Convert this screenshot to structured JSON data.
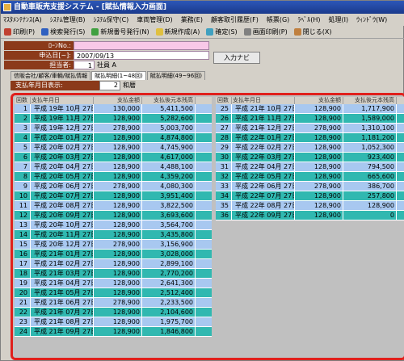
{
  "window": {
    "title": "自動車販売支援システム - [賦払情報入力画面]"
  },
  "menu": [
    "ﾏｽﾀﾒﾝﾃﾅﾝｽ(A)",
    "ｼｽﾃﾑ管理(B)",
    "ｼｽﾃﾑ保守(C)",
    "車両管理(D)",
    "業務(E)",
    "顧客取引履歴(F)",
    "帳票(G)",
    "ﾗﾍﾞﾙ(H)",
    "処理(I)",
    "ｳｨﾝﾄﾞｳ(W)"
  ],
  "toolbar": [
    "印刷(P)",
    "検索発行(S)",
    "新規番号発行(N)",
    "新規作成(A)",
    "確定(S)",
    "画面印刷(P)",
    "閉じる(X)"
  ],
  "form": {
    "loan_label": "ﾛｰﾝNo.:",
    "loan_value": "",
    "date_label": "申込日[~]:",
    "date_value": "2007/09/13",
    "person_label": "担当者:",
    "person_code": "1",
    "person_name": "社員 A"
  },
  "nav_button": "入力ナビ",
  "tabs": [
    "信販会社/顧客/車輛/賦払情報",
    "賦払明細(1~48回)",
    "賦払明細(49~96回)"
  ],
  "display": {
    "label": "支払年月日表示:",
    "value": "2",
    "text": "和暦"
  },
  "headers": [
    "回数",
    "支払年月日",
    "支払金額",
    "支払後元本残高"
  ],
  "left_rows": [
    [
      "1",
      "平成 19年 10月 27日",
      "130,000",
      "5,411,500"
    ],
    [
      "2",
      "平成 19年 11月 27日",
      "128,900",
      "5,282,600"
    ],
    [
      "3",
      "平成 19年 12月 27日",
      "278,900",
      "5,003,700"
    ],
    [
      "4",
      "平成 20年 01月 27日",
      "128,900",
      "4,874,800"
    ],
    [
      "5",
      "平成 20年 02月 27日",
      "128,900",
      "4,745,900"
    ],
    [
      "6",
      "平成 20年 03月 27日",
      "128,900",
      "4,617,000"
    ],
    [
      "7",
      "平成 20年 04月 27日",
      "128,900",
      "4,488,100"
    ],
    [
      "8",
      "平成 20年 05月 27日",
      "128,900",
      "4,359,200"
    ],
    [
      "9",
      "平成 20年 06月 27日",
      "278,900",
      "4,080,300"
    ],
    [
      "10",
      "平成 20年 07月 27日",
      "128,900",
      "3,951,400"
    ],
    [
      "11",
      "平成 20年 08月 27日",
      "128,900",
      "3,822,500"
    ],
    [
      "12",
      "平成 20年 09月 27日",
      "128,900",
      "3,693,600"
    ],
    [
      "13",
      "平成 20年 10月 27日",
      "128,900",
      "3,564,700"
    ],
    [
      "14",
      "平成 20年 11月 27日",
      "128,900",
      "3,435,800"
    ],
    [
      "15",
      "平成 20年 12月 27日",
      "278,900",
      "3,156,900"
    ],
    [
      "16",
      "平成 21年 01月 27日",
      "128,900",
      "3,028,000"
    ],
    [
      "17",
      "平成 21年 02月 27日",
      "128,900",
      "2,899,100"
    ],
    [
      "18",
      "平成 21年 03月 27日",
      "128,900",
      "2,770,200"
    ],
    [
      "19",
      "平成 21年 04月 27日",
      "128,900",
      "2,641,300"
    ],
    [
      "20",
      "平成 21年 05月 27日",
      "128,900",
      "2,512,400"
    ],
    [
      "21",
      "平成 21年 06月 27日",
      "278,900",
      "2,233,500"
    ],
    [
      "22",
      "平成 21年 07月 27日",
      "128,900",
      "2,104,600"
    ],
    [
      "23",
      "平成 21年 08月 27日",
      "128,900",
      "1,975,700"
    ],
    [
      "24",
      "平成 21年 09月 27日",
      "128,900",
      "1,846,800"
    ]
  ],
  "right_rows": [
    [
      "25",
      "平成 21年 10月 27日",
      "128,900",
      "1,717,900"
    ],
    [
      "26",
      "平成 21年 11月 27日",
      "128,900",
      "1,589,000"
    ],
    [
      "27",
      "平成 21年 12月 27日",
      "278,900",
      "1,310,100"
    ],
    [
      "28",
      "平成 22年 01月 27日",
      "128,900",
      "1,181,200"
    ],
    [
      "29",
      "平成 22年 02月 27日",
      "128,900",
      "1,052,300"
    ],
    [
      "30",
      "平成 22年 03月 27日",
      "128,900",
      "923,400"
    ],
    [
      "31",
      "平成 22年 04月 27日",
      "128,900",
      "794,500"
    ],
    [
      "32",
      "平成 22年 05月 27日",
      "128,900",
      "665,600"
    ],
    [
      "33",
      "平成 22年 06月 27日",
      "278,900",
      "386,700"
    ],
    [
      "34",
      "平成 22年 07月 27日",
      "128,900",
      "257,800"
    ],
    [
      "35",
      "平成 22年 08月 27日",
      "128,900",
      "128,900"
    ],
    [
      "36",
      "平成 22年 09月 27日",
      "128,900",
      "0"
    ]
  ]
}
